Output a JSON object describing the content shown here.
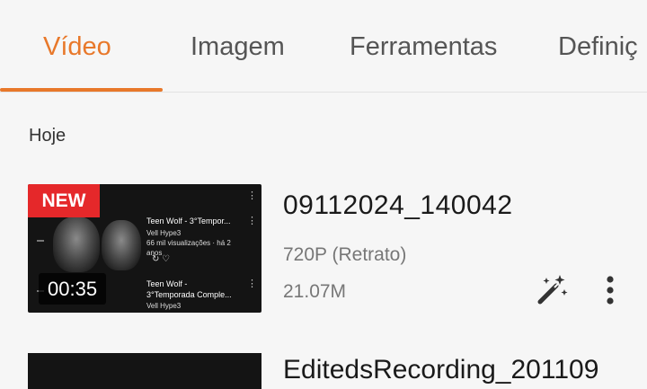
{
  "tabs": [
    {
      "label": "Vídeo",
      "active": true
    },
    {
      "label": "Imagem",
      "active": false
    },
    {
      "label": "Ferramentas",
      "active": false
    },
    {
      "label": "Definiç",
      "active": false
    }
  ],
  "accent_color": "#e8782a",
  "section": {
    "label": "Hoje"
  },
  "items": [
    {
      "title": "09112024_140042",
      "resolution": "720P (Retrato)",
      "size": "21.07M",
      "badge": "NEW",
      "duration": "00:35",
      "thumbnail": {
        "video1_title": "Teen Wolf - 3°Tempor...",
        "video1_channel": "Vell Hype3",
        "video1_stats": "66 mil visualizações · há 2",
        "video1_stats2": "anos",
        "video2_title": "Teen Wolf -",
        "video2_subtitle": "3°Temporada Comple...",
        "video2_channel": "Vell Hype3"
      },
      "actions": {
        "magic_icon": "magic-wand-icon",
        "more_icon": "more-vertical-icon"
      }
    },
    {
      "title": "EditedsRecording_201109"
    }
  ]
}
